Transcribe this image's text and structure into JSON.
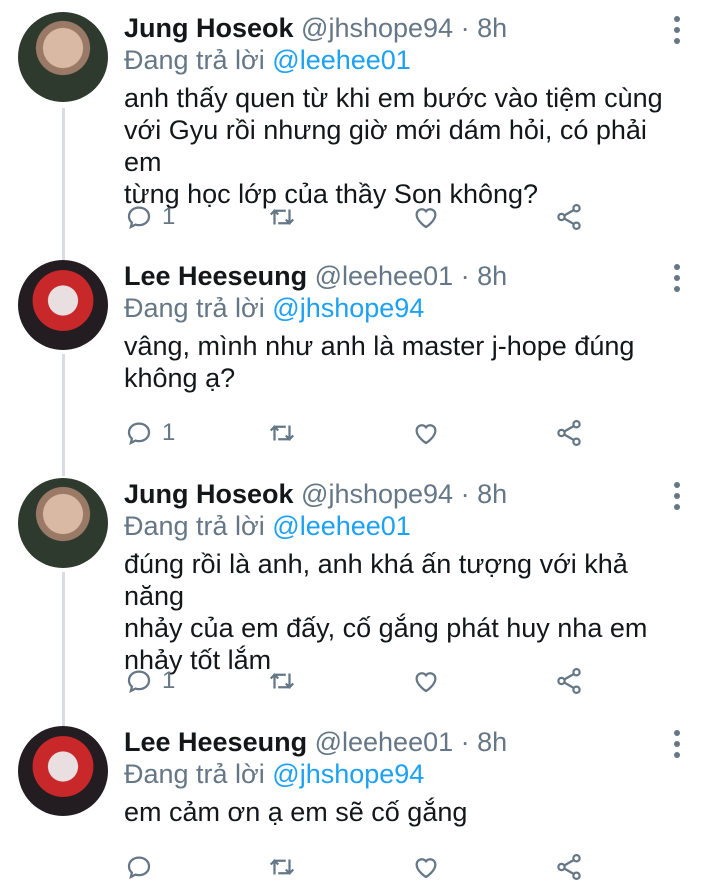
{
  "colors": {
    "accent": "#1da1f2",
    "muted": "#657786",
    "text": "#14171a",
    "thread": "#d9dde1"
  },
  "replying_label": "Đang trả lời",
  "tweets": [
    {
      "name": "Jung Hoseok",
      "handle": "@jhshope94",
      "dot": "·",
      "time": "8h",
      "replying_to": "@leehee01",
      "lines": [
        "anh thấy quen từ khi em bước vào tiệm cùng",
        "với Gyu rồi nhưng giờ mới dám hỏi, có phải em",
        "từng học lớp của thầy Son không?"
      ],
      "reply_count": "1",
      "avatar": "hoseok"
    },
    {
      "name": "Lee Heeseung",
      "handle": "@leehee01",
      "dot": "·",
      "time": "8h",
      "replying_to": "@jhshope94",
      "lines": [
        "vâng, mình như anh là master j-hope đúng",
        "không ạ?"
      ],
      "reply_count": "1",
      "avatar": "heeseung"
    },
    {
      "name": "Jung Hoseok",
      "handle": "@jhshope94",
      "dot": "·",
      "time": "8h",
      "replying_to": "@leehee01",
      "lines": [
        "đúng rồi là anh, anh khá ấn tượng với khả năng",
        "nhảy của em đấy, cố gắng phát huy nha em",
        "nhảy tốt lắm"
      ],
      "reply_count": "1",
      "avatar": "hoseok"
    },
    {
      "name": "Lee Heeseung",
      "handle": "@leehee01",
      "dot": "·",
      "time": "8h",
      "replying_to": "@jhshope94",
      "lines": [
        "em cảm ơn ạ em sẽ cố gắng"
      ],
      "reply_count": "",
      "avatar": "heeseung"
    }
  ],
  "icons": [
    "reply-icon",
    "retweet-icon",
    "like-icon",
    "share-icon",
    "more-icon"
  ]
}
